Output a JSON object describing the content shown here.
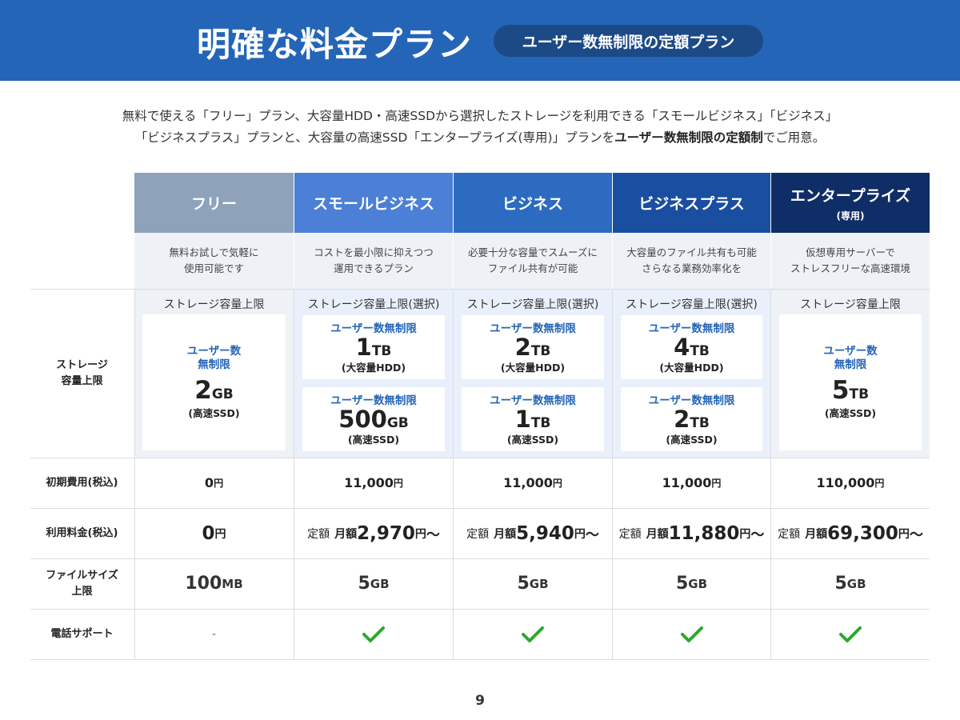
{
  "header": {
    "title": "明確な料金プラン",
    "pill": "ユーザー数無制限の定額プラン"
  },
  "intro": {
    "line1": "無料で使える「フリー」プラン、大容量HDD・高速SSDから選択したストレージを利用できる「スモールビジネス」「ビジネス」",
    "line2_before": "「ビジネスプラス」プランと、大容量の高速SSD「エンタープライズ(専用)」プランを",
    "line2_bold": "ユーザー数無制限の定額制",
    "line2_after": "でご用意。"
  },
  "colors": {
    "header_bg": "#2465b8",
    "pill_bg": "#1c4a86",
    "free": "#8ea3b9",
    "small_business": "#4c7fd6",
    "business": "#2c6bbf",
    "business_plus": "#1a4ea0",
    "enterprise": "#0f2d66",
    "check": "#2aa92a"
  },
  "plans": [
    {
      "id": "free",
      "name": "フリー",
      "sub": "",
      "desc": "無料お試しで気軽に\n使用可能です",
      "storage_caption": "ストレージ容量上限",
      "storage": [
        {
          "unlimited": "ユーザー数\n無制限",
          "amount": "2",
          "unit": "GB",
          "kind": "(高速SSD)"
        }
      ],
      "initial_fee": "0",
      "initial_fee_unit": "円",
      "usage_prefix": "",
      "usage_monthly": "",
      "usage_amount": "0",
      "usage_unit": "円",
      "usage_suffix": "",
      "file_size": "100",
      "file_size_unit": "MB",
      "phone_support": "-"
    },
    {
      "id": "small_business",
      "name": "スモールビジネス",
      "sub": "",
      "desc": "コストを最小限に抑えつつ\n運用できるプラン",
      "storage_caption": "ストレージ容量上限(選択)",
      "storage": [
        {
          "unlimited": "ユーザー数無制限",
          "amount": "1",
          "unit": "TB",
          "kind": "(大容量HDD)"
        },
        {
          "unlimited": "ユーザー数無制限",
          "amount": "500",
          "unit": "GB",
          "kind": "(高速SSD)"
        }
      ],
      "initial_fee": "11,000",
      "initial_fee_unit": "円",
      "usage_prefix": "定額",
      "usage_monthly": "月額",
      "usage_amount": "2,970",
      "usage_unit": "円",
      "usage_suffix": "〜",
      "file_size": "5",
      "file_size_unit": "GB",
      "phone_support": "check"
    },
    {
      "id": "business",
      "name": "ビジネス",
      "sub": "",
      "desc": "必要十分な容量でスムーズに\nファイル共有が可能",
      "storage_caption": "ストレージ容量上限(選択)",
      "storage": [
        {
          "unlimited": "ユーザー数無制限",
          "amount": "2",
          "unit": "TB",
          "kind": "(大容量HDD)"
        },
        {
          "unlimited": "ユーザー数無制限",
          "amount": "1",
          "unit": "TB",
          "kind": "(高速SSD)"
        }
      ],
      "initial_fee": "11,000",
      "initial_fee_unit": "円",
      "usage_prefix": "定額",
      "usage_monthly": "月額",
      "usage_amount": "5,940",
      "usage_unit": "円",
      "usage_suffix": "〜",
      "file_size": "5",
      "file_size_unit": "GB",
      "phone_support": "check"
    },
    {
      "id": "business_plus",
      "name": "ビジネスプラス",
      "sub": "",
      "desc": "大容量のファイル共有も可能\nさらなる業務効率化を",
      "storage_caption": "ストレージ容量上限(選択)",
      "storage": [
        {
          "unlimited": "ユーザー数無制限",
          "amount": "4",
          "unit": "TB",
          "kind": "(大容量HDD)"
        },
        {
          "unlimited": "ユーザー数無制限",
          "amount": "2",
          "unit": "TB",
          "kind": "(高速SSD)"
        }
      ],
      "initial_fee": "11,000",
      "initial_fee_unit": "円",
      "usage_prefix": "定額",
      "usage_monthly": "月額",
      "usage_amount": "11,880",
      "usage_unit": "円",
      "usage_suffix": "〜",
      "file_size": "5",
      "file_size_unit": "GB",
      "phone_support": "check"
    },
    {
      "id": "enterprise",
      "name": "エンタープライズ",
      "sub": "(専用)",
      "desc": "仮想専用サーバーで\nストレスフリーな高速環境",
      "storage_caption": "ストレージ容量上限",
      "storage": [
        {
          "unlimited": "ユーザー数\n無制限",
          "amount": "5",
          "unit": "TB",
          "kind": "(高速SSD)"
        }
      ],
      "initial_fee": "110,000",
      "initial_fee_unit": "円",
      "usage_prefix": "定額",
      "usage_monthly": "月額",
      "usage_amount": "69,300",
      "usage_unit": "円",
      "usage_suffix": "〜",
      "file_size": "5",
      "file_size_unit": "GB",
      "phone_support": "check"
    }
  ],
  "row_labels": {
    "storage": "ストレージ\n容量上限",
    "initial_fee": "初期費用(税込)",
    "usage_fee": "利用料金(税込)",
    "file_size": "ファイルサイズ\n上限",
    "phone_support": "電話サポート"
  },
  "page_number": "9"
}
